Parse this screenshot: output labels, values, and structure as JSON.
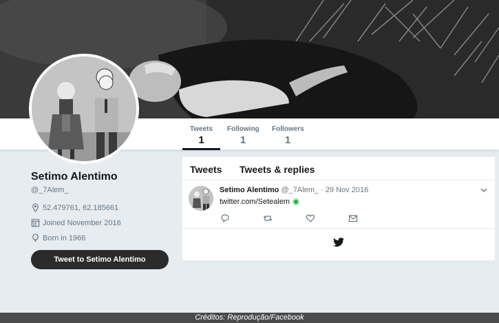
{
  "profile": {
    "name": "Setimo Alentimo",
    "handle": "@_7Alem_",
    "location": "52.479761, 62.185661",
    "joined": "Joined November 2016",
    "born": "Born in 1966",
    "tweet_to_label": "Tweet to Setimo Alentimo"
  },
  "nav": {
    "tweets_label": "Tweets",
    "tweets_count": "1",
    "following_label": "Following",
    "following_count": "1",
    "followers_label": "Followers",
    "followers_count": "1"
  },
  "timeline": {
    "tab_tweets": "Tweets",
    "tab_replies": "Tweets & replies",
    "tweet": {
      "name": "Setimo Alentimo",
      "meta": "@_7Alem_ · 29 Nov 2016",
      "text": "twitter.com/Setealem"
    }
  },
  "caption": "Créditos: Reprodução/Facebook",
  "icons": [
    "location-icon",
    "calendar-icon",
    "balloon-icon",
    "reply-icon",
    "retweet-icon",
    "like-icon",
    "message-icon",
    "chevron-down-icon",
    "twitter-bird-icon"
  ],
  "colors": {
    "background": "#e6ecf0",
    "button": "#2b2b2b",
    "secondary_text": "#657786"
  }
}
